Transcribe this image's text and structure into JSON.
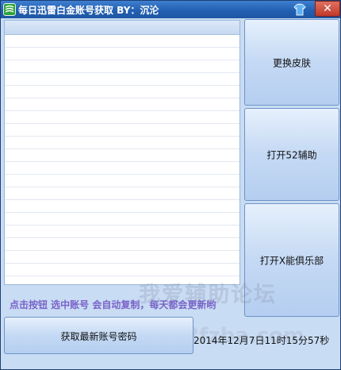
{
  "window": {
    "title": "每日迅雷白金账号获取 BY：沉沦",
    "close_label": "✕"
  },
  "buttons": {
    "change_skin": "更换皮肤",
    "open_52": "打开52辅助",
    "open_x": "打开X能俱乐部",
    "get_account": "获取最新账号密码"
  },
  "hint": "点击按钮 选中账号 会自动复制，每天都会更新哟",
  "watermark": {
    "main": "我爱辅助论坛",
    "sub": "52fzba.com"
  },
  "timestamp": "2014年12月7日11时15分57秒",
  "colors": {
    "titlebar": "#2360b2",
    "window_bg": "#c8dcf4",
    "hint": "#7a63c8",
    "close": "#c0392b"
  }
}
